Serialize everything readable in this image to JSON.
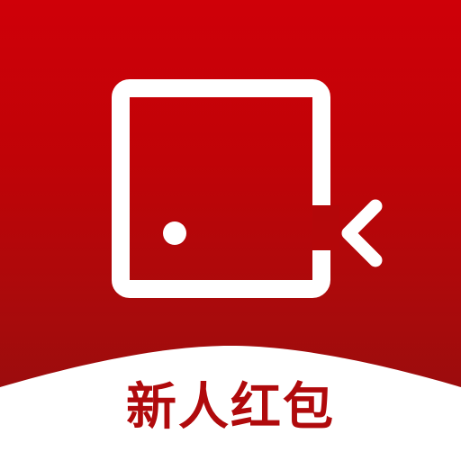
{
  "badge": {
    "label": "新人红包"
  },
  "logo": {
    "icon": "video-record-play-icon"
  },
  "colors": {
    "background_top": "#cf0008",
    "background_bottom": "#8f0d0e",
    "logo_stroke": "#ffffff",
    "banner": "#ffffff",
    "caption": "#b00a0c"
  }
}
